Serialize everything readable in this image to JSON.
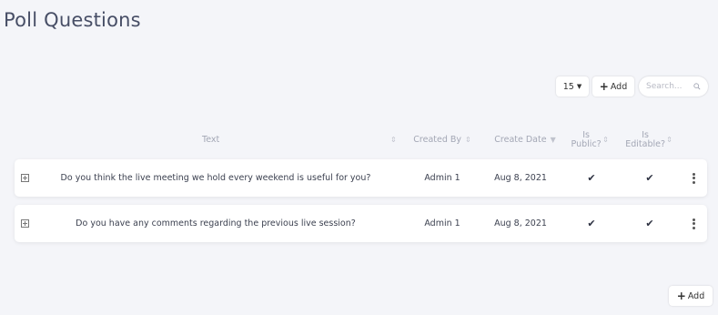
{
  "page": {
    "title": "Poll Questions"
  },
  "toolbar": {
    "page_size": "15",
    "add_label": "Add",
    "search_placeholder": "Search..."
  },
  "table": {
    "columns": {
      "text": "Text",
      "created_by": "Created By",
      "create_date": "Create Date",
      "is_public": "Is Public?",
      "is_editable": "Is Editable?"
    },
    "rows": [
      {
        "text": "Do you think the live meeting we hold every weekend is useful for you?",
        "created_by": "Admin 1",
        "create_date": "Aug 8, 2021",
        "is_public": "✔",
        "is_editable": "✔"
      },
      {
        "text": "Do you have any comments regarding the previous live session?",
        "created_by": "Admin 1",
        "create_date": "Aug 8, 2021",
        "is_public": "✔",
        "is_editable": "✔"
      }
    ]
  },
  "footer": {
    "add_label": "Add"
  }
}
